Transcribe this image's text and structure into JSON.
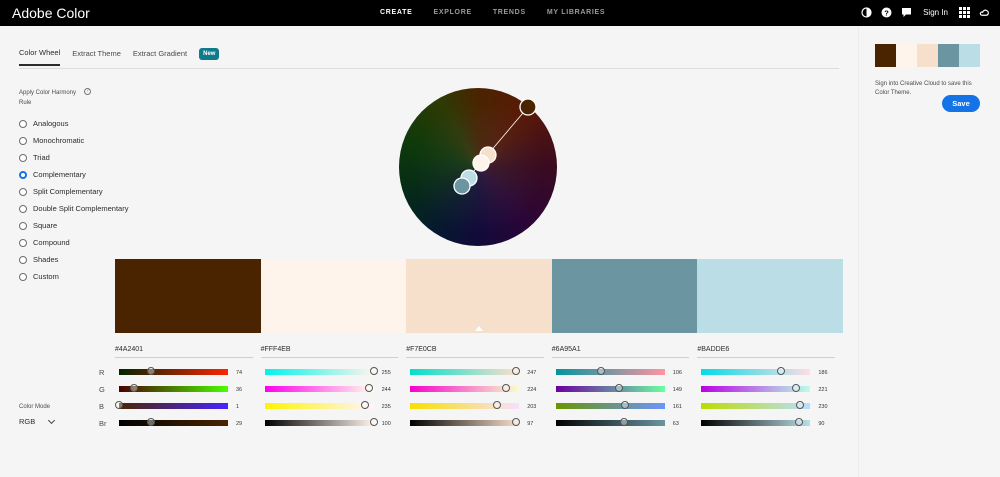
{
  "app": {
    "title": "Adobe Color"
  },
  "nav": [
    {
      "label": "CREATE",
      "active": true
    },
    {
      "label": "EXPLORE",
      "active": false
    },
    {
      "label": "TRENDS",
      "active": false
    },
    {
      "label": "MY LIBRARIES",
      "active": false
    }
  ],
  "topright": {
    "signin": "Sign In",
    "icons": [
      "accessibility-icon",
      "help-icon",
      "feedback-icon",
      "apps-grid-icon",
      "creative-cloud-icon"
    ]
  },
  "tabs": [
    {
      "label": "Color Wheel",
      "active": true
    },
    {
      "label": "Extract Theme",
      "active": false
    },
    {
      "label": "Extract Gradient",
      "active": false
    }
  ],
  "new_badge": "New",
  "harmony": {
    "label": "Apply Color Harmony Rule",
    "options": [
      "Analogous",
      "Monochromatic",
      "Triad",
      "Complementary",
      "Split Complementary",
      "Double Split Complementary",
      "Square",
      "Compound",
      "Shades",
      "Custom"
    ],
    "selected": "Complementary"
  },
  "color_mode": {
    "label": "Color Mode",
    "value": "RGB"
  },
  "colors": [
    {
      "hex": "#4A2401",
      "css": "#4a2401",
      "r": 74,
      "g": 36,
      "b": 1,
      "br": 29
    },
    {
      "hex": "#FFF4EB",
      "css": "#fff4eb",
      "r": 255,
      "g": 244,
      "b": 235,
      "br": 100
    },
    {
      "hex": "#F7E0CB",
      "css": "#f7e0cb",
      "r": 247,
      "g": 224,
      "b": 203,
      "br": 97
    },
    {
      "hex": "#6A95A1",
      "css": "#6a95a1",
      "r": 106,
      "g": 149,
      "b": 161,
      "br": 63
    },
    {
      "hex": "#BADDE6",
      "css": "#badde6",
      "r": 186,
      "g": 221,
      "b": 230,
      "br": 90
    }
  ],
  "selected_swatch": 2,
  "channels": [
    "R",
    "G",
    "B",
    "Br"
  ],
  "panel": {
    "message": "Sign into Creative Cloud to save this Color Theme.",
    "save_label": "Save"
  }
}
